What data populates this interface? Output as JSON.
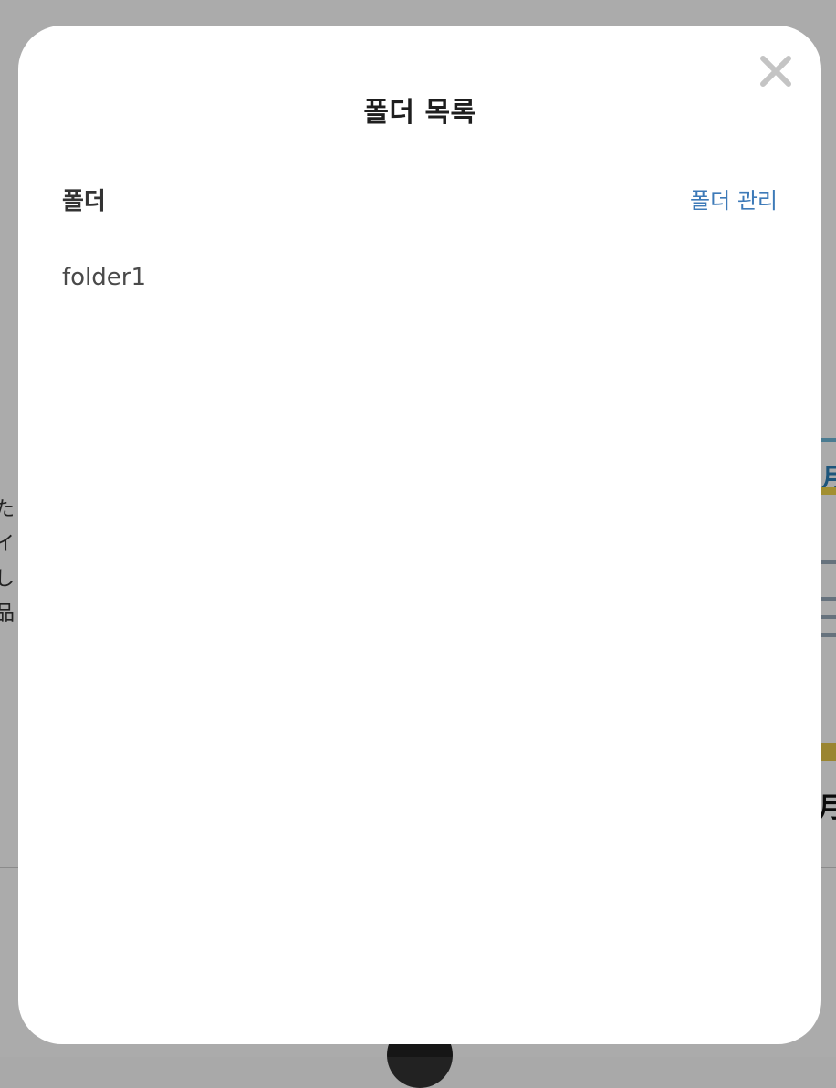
{
  "modal": {
    "title": "폴더 목록",
    "close_icon": "close-icon",
    "section_label": "폴더",
    "manage_link_label": "폴더 관리",
    "folders": [
      {
        "name": "folder1"
      }
    ]
  },
  "background": {
    "left_text_lines": [
      "た",
      "イ",
      "し",
      "品"
    ],
    "right_card_title": "月",
    "right_bottom_title": "月"
  },
  "colors": {
    "overlay": "#a9a9a9",
    "link": "#3d7ab8",
    "title": "#1e1e1e"
  }
}
